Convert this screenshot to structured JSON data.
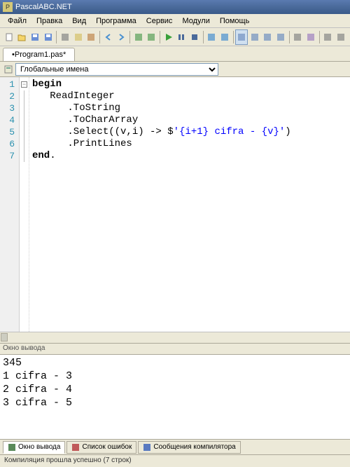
{
  "window": {
    "title": "PascalABC.NET"
  },
  "menu": {
    "items": [
      "Файл",
      "Правка",
      "Вид",
      "Программа",
      "Сервис",
      "Модули",
      "Помощь"
    ]
  },
  "tab": {
    "label": "•Program1.pas*"
  },
  "scope": {
    "label": "Глобальные имена"
  },
  "code": {
    "lines": [
      {
        "n": "1",
        "indent": "",
        "tokens": [
          {
            "t": "begin",
            "c": "kw"
          }
        ]
      },
      {
        "n": "2",
        "indent": "   ",
        "tokens": [
          {
            "t": "ReadInteger",
            "c": ""
          }
        ]
      },
      {
        "n": "3",
        "indent": "      ",
        "tokens": [
          {
            "t": ".ToString",
            "c": ""
          }
        ]
      },
      {
        "n": "4",
        "indent": "      ",
        "tokens": [
          {
            "t": ".ToCharArray",
            "c": ""
          }
        ]
      },
      {
        "n": "5",
        "indent": "      ",
        "tokens": [
          {
            "t": ".Select((v,i) -> $",
            "c": ""
          },
          {
            "t": "'{i+1} cifra - {v}'",
            "c": "str"
          },
          {
            "t": ")",
            "c": ""
          }
        ]
      },
      {
        "n": "6",
        "indent": "      ",
        "tokens": [
          {
            "t": ".PrintLines",
            "c": ""
          }
        ]
      },
      {
        "n": "7",
        "indent": "",
        "tokens": [
          {
            "t": "end",
            "c": "kw"
          },
          {
            "t": ".",
            "c": ""
          }
        ]
      }
    ]
  },
  "output": {
    "header": "Окно вывода",
    "lines": [
      "345",
      "1 cifra - 3",
      "2 cifra - 4",
      "3 cifra - 5",
      ""
    ]
  },
  "bottom_tabs": {
    "items": [
      {
        "label": "Окно вывода",
        "icon": "output"
      },
      {
        "label": "Список ошибок",
        "icon": "errors"
      },
      {
        "label": "Сообщения компилятора",
        "icon": "messages"
      }
    ]
  },
  "status": {
    "text": "Компиляция прошла успешно (7 строк)"
  },
  "toolbar_icons": [
    "new",
    "open",
    "save",
    "save-all",
    "sep",
    "cut",
    "copy",
    "paste",
    "sep",
    "undo",
    "redo",
    "sep",
    "back",
    "fwd",
    "sep",
    "run",
    "pause",
    "stop",
    "sep",
    "step-into",
    "step-over",
    "sep",
    "panel1",
    "panel2",
    "panel3",
    "panel4",
    "sep",
    "find",
    "module",
    "sep",
    "x1",
    "x2"
  ]
}
